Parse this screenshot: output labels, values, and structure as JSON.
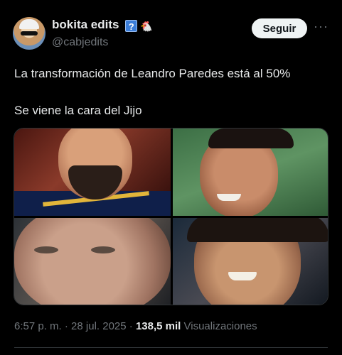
{
  "author": {
    "display_name": "bokita edits",
    "badge": "?",
    "emoji": "🐔",
    "handle": "@cabjedits"
  },
  "follow_label": "Seguir",
  "more_label": "···",
  "tweet": {
    "line1": "La transformación de Leandro Paredes está al 50%",
    "line2": "Se viene la cara del Jijo"
  },
  "media": [
    {
      "id": "photo-1"
    },
    {
      "id": "photo-2"
    },
    {
      "id": "photo-3"
    },
    {
      "id": "photo-4"
    }
  ],
  "meta": {
    "time": "6:57 p. m.",
    "sep1": " · ",
    "date": "28 jul. 2025",
    "sep2": " · ",
    "views_count": "138,5 mil",
    "views_label": " Visualizaciones"
  },
  "colors": {
    "background": "#000000",
    "text_primary": "#e7e9ea",
    "text_secondary": "#71767b",
    "follow_button_bg": "#eff3f4"
  }
}
